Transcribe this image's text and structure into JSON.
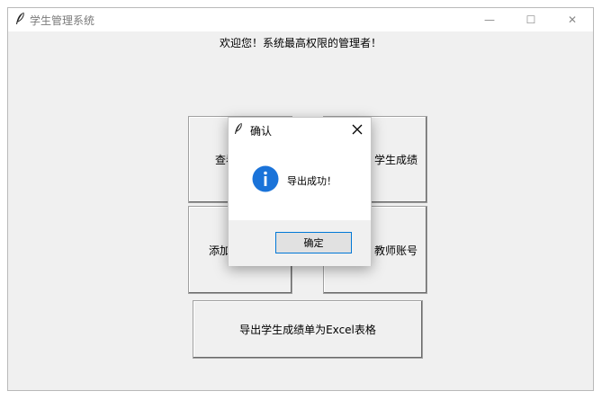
{
  "window": {
    "title": "学生管理系统",
    "controls": {
      "minimize": "—",
      "maximize": "☐",
      "close": "✕"
    }
  },
  "welcome_text": "欢迎您！系统最高权限的管理者！",
  "buttons": {
    "view_student": "查看学",
    "view_scores_suffix": "学生成绩",
    "add": "添加",
    "teacher_account_suffix": "教师账号",
    "export": "导出学生成绩单为Excel表格"
  },
  "dialog": {
    "title": "确认",
    "message": "导出成功！",
    "ok_label": "确定",
    "icon": "info-icon"
  },
  "colors": {
    "accent": "#0078d7",
    "info_icon": "#1a73d9"
  }
}
